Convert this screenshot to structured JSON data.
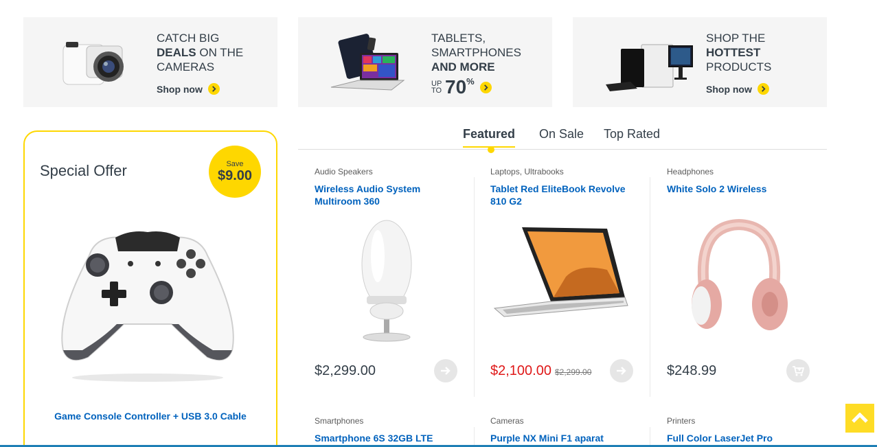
{
  "banners": [
    {
      "line1": "CATCH BIG",
      "bold": "DEALS",
      "line2_rest": " ON THE",
      "line3": "CAMERAS",
      "cta": "Shop now",
      "image": "camera-image"
    },
    {
      "line1": "TABLETS,",
      "line2": "SMARTPHONES",
      "bold": "AND MORE",
      "upto_top": "UP",
      "upto_bottom": "TO",
      "percent_value": "70",
      "percent_sign": "%",
      "image": "tablet-laptop-image"
    },
    {
      "line1": "SHOP THE",
      "bold": "HOTTEST",
      "line3": "PRODUCTS",
      "cta": "Shop now",
      "image": "desktop-computer-image"
    }
  ],
  "special_offer": {
    "title": "Special Offer",
    "save_label": "Save",
    "save_amount": "$9.00",
    "product_name": "Game Console Controller + USB 3.0 Cable",
    "image": "game-controller-image"
  },
  "tabs": [
    {
      "label": "Featured",
      "active": true
    },
    {
      "label": "On Sale",
      "active": false
    },
    {
      "label": "Top Rated",
      "active": false
    }
  ],
  "products": [
    {
      "category": "Audio Speakers",
      "name": "Wireless Audio System Multiroom 360",
      "price": "$2,299.00",
      "action_icon": "arrow-right-icon"
    },
    {
      "category": "Laptops, Ultrabooks",
      "name": "Tablet Red EliteBook Revolve 810 G2",
      "price": "$2,100.00",
      "old_price": "$2,299.00",
      "action_icon": "arrow-right-icon"
    },
    {
      "category": "Headphones",
      "name": "White Solo 2 Wireless",
      "price": "$248.99",
      "action_icon": "add-to-cart-icon"
    }
  ],
  "products_row2": [
    {
      "category": "Smartphones",
      "name": "Smartphone 6S 32GB LTE"
    },
    {
      "category": "Cameras",
      "name": "Purple NX Mini F1 aparat"
    },
    {
      "category": "Printers",
      "name": "Full Color LaserJet Pro"
    }
  ],
  "colors": {
    "accent": "#fed700",
    "link": "#0062bd",
    "sale": "#df1818",
    "text": "#333e48"
  }
}
